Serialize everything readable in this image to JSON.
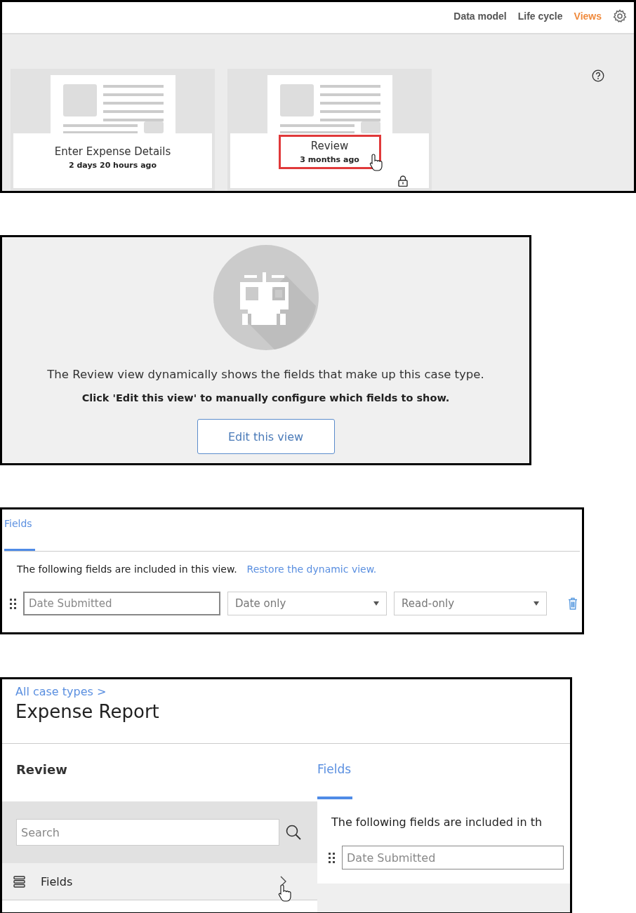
{
  "views_screen": {
    "nav": [
      {
        "label": "Data model",
        "selected": false
      },
      {
        "label": "Life cycle",
        "selected": false
      },
      {
        "label": "Views",
        "selected": true
      }
    ],
    "cards": [
      {
        "title": "Enter Expense Details",
        "time": "2 days 20 hours ago",
        "highlighted": false,
        "locked": false
      },
      {
        "title": "Review",
        "time": "3 months ago",
        "highlighted": true,
        "locked": true
      }
    ]
  },
  "review_empty_state": {
    "message": "The Review view dynamically shows the fields that make up this case type.",
    "instruction": "Click 'Edit this view' to manually configure which fields to show.",
    "button": "Edit this view"
  },
  "fields_editor": {
    "tabs": [
      {
        "label": "Fields",
        "selected": true
      }
    ],
    "intro": "The following fields are included in this view.",
    "link": "Restore the dynamic view.",
    "rows": [
      {
        "placeholder": "Date Submitted",
        "format": "Date only",
        "mode": "Read-only"
      }
    ]
  },
  "case_type_editor": {
    "breadcrumb": "All case types >",
    "title": "Expense Report",
    "sidebar": {
      "heading": "Review",
      "search_placeholder": "Search",
      "items": [
        {
          "label": "Fields",
          "selected": true
        }
      ]
    },
    "tabs": [
      {
        "label": "Fields",
        "selected": true
      }
    ],
    "intro": "The following fields are included in th",
    "rows": [
      {
        "placeholder": "Date Submitted"
      }
    ]
  }
}
